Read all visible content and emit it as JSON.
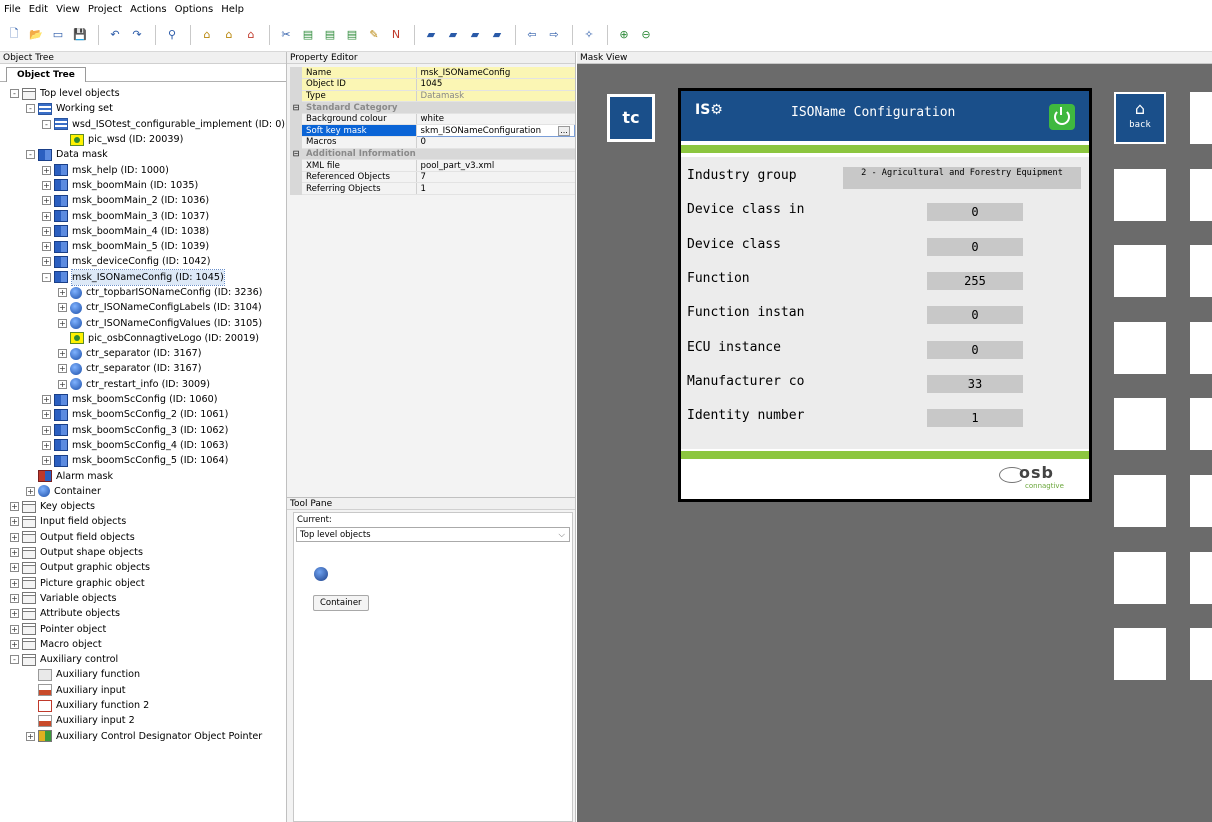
{
  "menu": [
    "File",
    "Edit",
    "View",
    "Project",
    "Actions",
    "Options",
    "Help"
  ],
  "panels": {
    "object_tree": "Object Tree",
    "object_tree_tab": "Object Tree",
    "property_editor": "Property Editor",
    "tool_pane": "Tool Pane",
    "mask_view": "Mask View"
  },
  "tree": [
    {
      "label": "Top level objects",
      "icon": "folder",
      "expand": "-",
      "level": 0
    },
    {
      "label": "Working set",
      "icon": "ws",
      "expand": "-",
      "level": 1
    },
    {
      "label": "wsd_ISOtest_configurable_implement (ID: 0)",
      "icon": "ws",
      "expand": "-",
      "level": 2
    },
    {
      "label": "pic_wsd (ID: 20039)",
      "icon": "pic",
      "expand": "",
      "level": 3
    },
    {
      "label": "Data mask",
      "icon": "mask",
      "expand": "-",
      "level": 1
    },
    {
      "label": "msk_help (ID: 1000)",
      "icon": "mask",
      "expand": "+",
      "level": 2
    },
    {
      "label": "msk_boomMain (ID: 1035)",
      "icon": "mask",
      "expand": "+",
      "level": 2
    },
    {
      "label": "msk_boomMain_2 (ID: 1036)",
      "icon": "mask",
      "expand": "+",
      "level": 2
    },
    {
      "label": "msk_boomMain_3 (ID: 1037)",
      "icon": "mask",
      "expand": "+",
      "level": 2
    },
    {
      "label": "msk_boomMain_4 (ID: 1038)",
      "icon": "mask",
      "expand": "+",
      "level": 2
    },
    {
      "label": "msk_boomMain_5 (ID: 1039)",
      "icon": "mask",
      "expand": "+",
      "level": 2
    },
    {
      "label": "msk_deviceConfig (ID: 1042)",
      "icon": "mask",
      "expand": "+",
      "level": 2
    },
    {
      "label": "msk_ISONameConfig (ID: 1045)",
      "icon": "mask",
      "expand": "-",
      "level": 2,
      "selected": true
    },
    {
      "label": "ctr_topbarISONameConfig (ID: 3236)",
      "icon": "ctr",
      "expand": "+",
      "level": 3
    },
    {
      "label": "ctr_ISONameConfigLabels (ID: 3104)",
      "icon": "ctr",
      "expand": "+",
      "level": 3
    },
    {
      "label": "ctr_ISONameConfigValues (ID: 3105)",
      "icon": "ctr",
      "expand": "+",
      "level": 3
    },
    {
      "label": "pic_osbConnagtiveLogo (ID: 20019)",
      "icon": "pic",
      "expand": "",
      "level": 3
    },
    {
      "label": "ctr_separator (ID: 3167)",
      "icon": "ctr",
      "expand": "+",
      "level": 3
    },
    {
      "label": "ctr_separator (ID: 3167)",
      "icon": "ctr",
      "expand": "+",
      "level": 3
    },
    {
      "label": "ctr_restart_info (ID: 3009)",
      "icon": "ctr",
      "expand": "+",
      "level": 3
    },
    {
      "label": "msk_boomScConfig (ID: 1060)",
      "icon": "mask",
      "expand": "+",
      "level": 2
    },
    {
      "label": "msk_boomScConfig_2 (ID: 1061)",
      "icon": "mask",
      "expand": "+",
      "level": 2
    },
    {
      "label": "msk_boomScConfig_3 (ID: 1062)",
      "icon": "mask",
      "expand": "+",
      "level": 2
    },
    {
      "label": "msk_boomScConfig_4 (ID: 1063)",
      "icon": "mask",
      "expand": "+",
      "level": 2
    },
    {
      "label": "msk_boomScConfig_5 (ID: 1064)",
      "icon": "mask",
      "expand": "+",
      "level": 2
    },
    {
      "label": "Alarm mask",
      "icon": "alarm",
      "expand": "",
      "level": 1
    },
    {
      "label": "Container",
      "icon": "ctr",
      "expand": "+",
      "level": 1
    },
    {
      "label": "Key objects",
      "icon": "folder",
      "expand": "+",
      "level": 0
    },
    {
      "label": "Input field objects",
      "icon": "folder",
      "expand": "+",
      "level": 0
    },
    {
      "label": "Output field objects",
      "icon": "folder",
      "expand": "+",
      "level": 0
    },
    {
      "label": "Output shape objects",
      "icon": "folder",
      "expand": "+",
      "level": 0
    },
    {
      "label": "Output graphic objects",
      "icon": "folder",
      "expand": "+",
      "level": 0
    },
    {
      "label": "Picture graphic object",
      "icon": "folder",
      "expand": "+",
      "level": 0
    },
    {
      "label": "Variable objects",
      "icon": "folder",
      "expand": "+",
      "level": 0
    },
    {
      "label": "Attribute objects",
      "icon": "folder",
      "expand": "+",
      "level": 0
    },
    {
      "label": "Pointer object",
      "icon": "folder",
      "expand": "+",
      "level": 0
    },
    {
      "label": "Macro object",
      "icon": "folder",
      "expand": "+",
      "level": 0
    },
    {
      "label": "Auxiliary control",
      "icon": "folder",
      "expand": "-",
      "level": 0
    },
    {
      "label": "Auxiliary function",
      "icon": "aux",
      "expand": "",
      "level": 1
    },
    {
      "label": "Auxiliary input",
      "icon": "auxin",
      "expand": "",
      "level": 1
    },
    {
      "label": "Auxiliary function 2",
      "icon": "auxf2",
      "expand": "",
      "level": 1
    },
    {
      "label": "Auxiliary input 2",
      "icon": "auxin",
      "expand": "",
      "level": 1
    },
    {
      "label": "Auxiliary Control Designator Object Pointer",
      "icon": "auxptr",
      "expand": "+",
      "level": 1
    }
  ],
  "properties": [
    {
      "type": "yel",
      "key": "Name",
      "value": "msk_ISONameConfig"
    },
    {
      "type": "yel",
      "key": "Object ID",
      "value": "1045"
    },
    {
      "type": "yel gray",
      "key": "Type",
      "value": "Datamask"
    },
    {
      "type": "cat",
      "key": "Standard Category",
      "value": ""
    },
    {
      "type": "",
      "key": "Background colour",
      "value": "white"
    },
    {
      "type": "sel",
      "key": "Soft key mask",
      "value": "skm_ISONameConfiguration"
    },
    {
      "type": "",
      "key": "Macros",
      "value": "0"
    },
    {
      "type": "cat",
      "key": "Additional Information",
      "value": ""
    },
    {
      "type": "",
      "key": "XML file",
      "value": "pool_part_v3.xml"
    },
    {
      "type": "",
      "key": "Referenced Objects",
      "value": "7"
    },
    {
      "type": "",
      "key": "Referring Objects",
      "value": "1"
    }
  ],
  "tool_pane": {
    "current_label": "Current:",
    "current_value": "Top level objects",
    "container_button": "Container"
  },
  "mask": {
    "tc_label": "tc",
    "iso_logo": "IS⚙",
    "title": "ISOName Configuration",
    "rows": [
      {
        "label": "Industry group",
        "value": "2 - Agricultural and Forestry Equipment",
        "wide": true
      },
      {
        "label": "Device class in",
        "value": "0"
      },
      {
        "label": "Device class",
        "value": "0"
      },
      {
        "label": "Function",
        "value": "255"
      },
      {
        "label": "Function instan",
        "value": "0"
      },
      {
        "label": "ECU instance",
        "value": "0"
      },
      {
        "label": "Manufacturer co",
        "value": "33"
      },
      {
        "label": "Identity number",
        "value": "1"
      }
    ],
    "osb_logo": "osb",
    "osb_sub": "connagtive",
    "back_label": "back"
  },
  "colors": {
    "isobus_blue": "#1a4f8a",
    "separator_green": "#8cc63f",
    "selection_blue": "#0a64d6",
    "identity_yellow": "#fbf6b4",
    "mask_background": "#6b6b6b"
  }
}
